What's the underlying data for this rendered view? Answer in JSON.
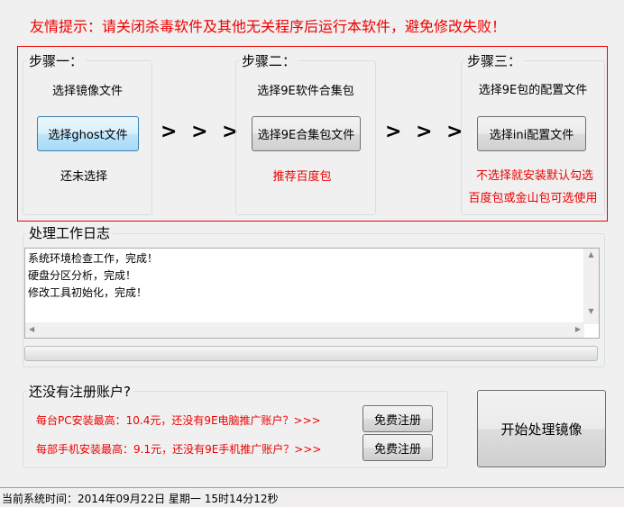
{
  "warning": "友情提示：请关闭杀毒软件及其他无关程序后运行本软件，避免修改失败！",
  "steps": [
    {
      "legend": "步骤一：",
      "desc": "选择镜像文件",
      "button": "选择ghost文件",
      "note": "还未选择"
    },
    {
      "legend": "步骤二：",
      "desc": "选择9E软件合集包",
      "button": "选择9E合集包文件",
      "note": "推荐百度包"
    },
    {
      "legend": "步骤三：",
      "desc": "选择9E包的配置文件",
      "button": "选择ini配置文件",
      "note": "不选择就安装默认勾选",
      "note2": "百度包或金山包可选使用"
    }
  ],
  "arrows": "> > > >",
  "log": {
    "legend": "处理工作日志",
    "lines": [
      "系统环境检查工作，完成！",
      "硬盘分区分析，完成！",
      "修改工具初始化，完成！"
    ],
    "progress": 0
  },
  "register": {
    "legend": "还没有注册账户?",
    "pc_text": "每台PC安装最高：10.4元，还没有9E电脑推广账户？>>>",
    "mobile_text": "每部手机安装最高：9.1元，还没有9E手机推广账户？>>>",
    "button": "免费注册"
  },
  "start_button": "开始处理镜像",
  "status": "当前系统时间：2014年09月22日 星期一 15时14分12秒"
}
